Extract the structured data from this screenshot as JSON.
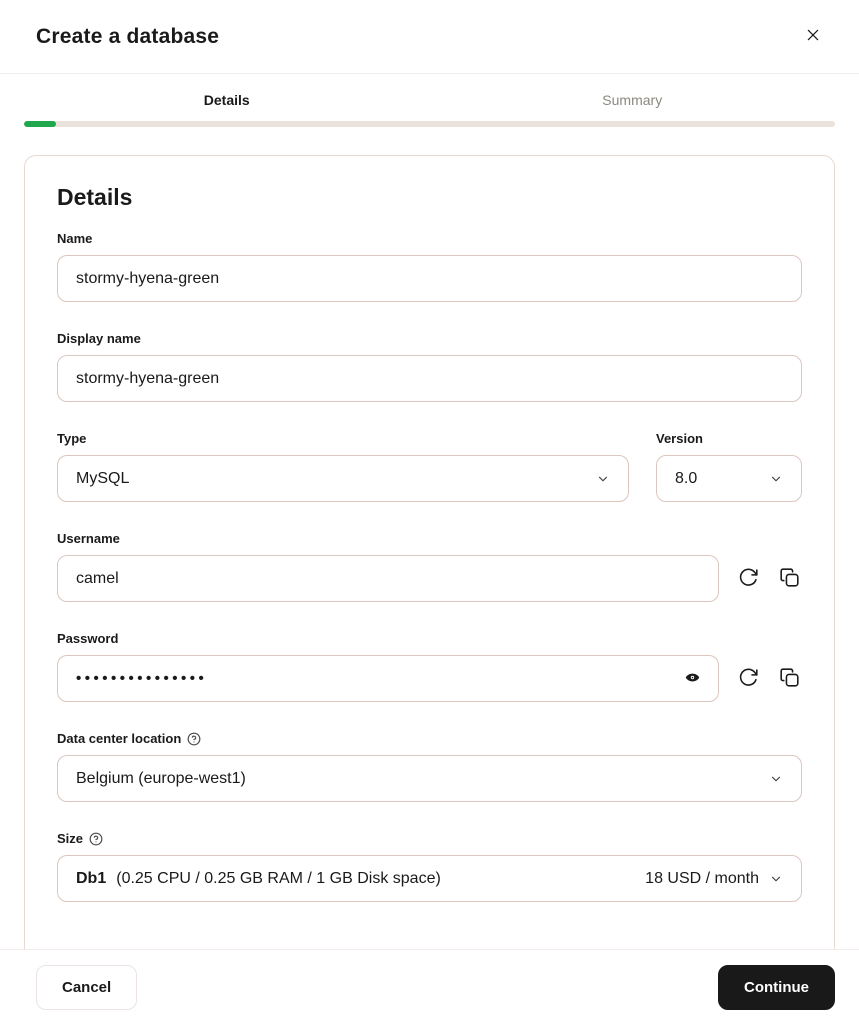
{
  "modal": {
    "title": "Create a database"
  },
  "steps": {
    "tabs": [
      {
        "label": "Details"
      },
      {
        "label": "Summary"
      }
    ],
    "progress_percent": 4
  },
  "form": {
    "heading": "Details",
    "name": {
      "label": "Name",
      "value": "stormy-hyena-green"
    },
    "display_name": {
      "label": "Display name",
      "value": "stormy-hyena-green"
    },
    "type": {
      "label": "Type",
      "value": "MySQL"
    },
    "version": {
      "label": "Version",
      "value": "8.0"
    },
    "username": {
      "label": "Username",
      "value": "camel"
    },
    "password": {
      "label": "Password",
      "masked_value": "•••••••••••••••"
    },
    "location": {
      "label": "Data center location",
      "value": "Belgium (europe-west1)"
    },
    "size": {
      "label": "Size",
      "plan": "Db1",
      "specs": "(0.25 CPU / 0.25 GB RAM / 1 GB Disk space)",
      "price": "18 USD / month"
    }
  },
  "footer": {
    "cancel_label": "Cancel",
    "continue_label": "Continue"
  },
  "icons": {
    "close": "✕",
    "chevron_down": "⌄",
    "regenerate": "↻",
    "copy": "⧉",
    "eye": "👁",
    "help": "?"
  },
  "colors": {
    "accent_green": "#21a74e",
    "input_border": "#dbc7be",
    "card_border": "#e7d9d1",
    "progress_track": "#ece2dc",
    "inactive_text": "#8d8780",
    "primary_button_bg": "#191919"
  }
}
